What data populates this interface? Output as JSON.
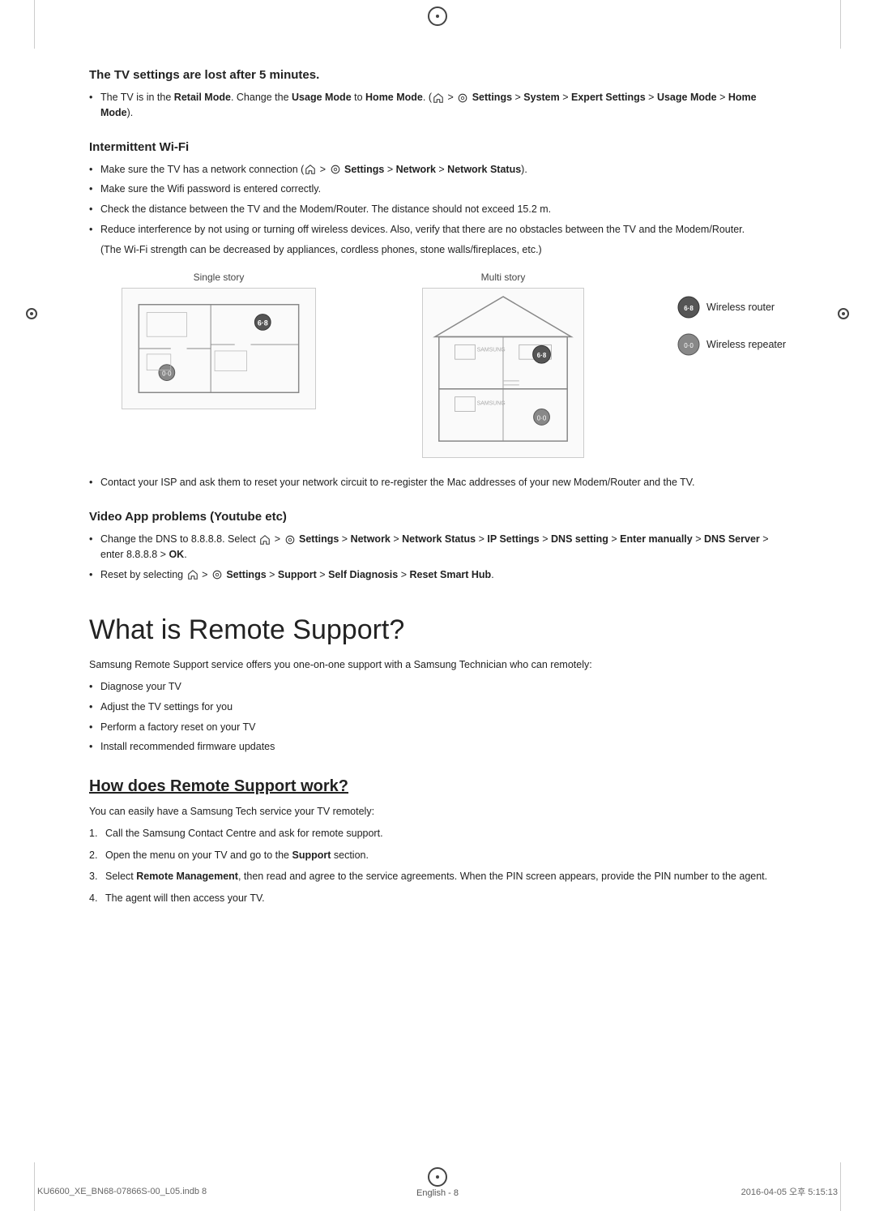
{
  "page": {
    "title": "What is Remote Support?",
    "footer": {
      "left": "KU6600_XE_BN68-07866S-00_L05.indb   8",
      "center": "English - 8",
      "right": "2016-04-05   오후 5:15:13"
    }
  },
  "sections": {
    "tv_settings": {
      "heading": "The TV settings are lost after 5 minutes.",
      "bullet1": "The TV is in the Retail Mode. Change the Usage Mode to Home Mode. (Home > Settings > System > Expert Settings > Usage Mode > Home Mode)."
    },
    "intermittent_wifi": {
      "heading": "Intermittent Wi-Fi",
      "bullet1": "Make sure the TV has a network connection (Home > Settings > Network > Network Status).",
      "bullet2": "Make sure the Wifi password is entered correctly.",
      "bullet3": "Check the distance between the TV and the Modem/Router. The distance should not exceed 15.2 m.",
      "bullet4": "Reduce interference by not using or turning off wireless devices. Also, verify that there are no obstacles between the TV and the Modem/Router.",
      "note": "(The Wi-Fi strength can be decreased by appliances, cordless phones, stone walls/fireplaces, etc.)",
      "diagram_label_left": "Single story",
      "diagram_label_right": "Multi story",
      "legend_router": "Wireless router",
      "legend_repeater": "Wireless repeater",
      "bullet5": "Contact your ISP and ask them to reset your network circuit to re-register the Mac addresses of your new Modem/Router and the TV."
    },
    "video_app": {
      "heading": "Video App problems (Youtube etc)",
      "bullet1_pre": "Change the DNS to 8.8.8.8. Select",
      "bullet1_nav": "Home > Settings > Network > Network Status > IP Settings > DNS setting > Enter manually > DNS Server > enter 8.8.8.8 > OK",
      "bullet2_pre": "Reset by selecting",
      "bullet2_nav": "Home > Settings > Support > Self Diagnosis > Reset Smart Hub",
      "bullet2_end": "."
    },
    "remote_support": {
      "heading": "What is Remote Support?",
      "intro": "Samsung Remote Support service offers you one-on-one support with a Samsung Technician who can remotely:",
      "bullet1": "Diagnose your TV",
      "bullet2": "Adjust the TV settings for you",
      "bullet3": "Perform a factory reset on your TV",
      "bullet4": "Install recommended firmware updates"
    },
    "how_it_works": {
      "heading": "How does Remote Support work?",
      "intro": "You can easily have a Samsung Tech service your TV remotely:",
      "step1": "Call the Samsung Contact Centre and ask for remote support.",
      "step2": "Open the menu on your TV and go to the Support section.",
      "step3": "Select Remote Management, then read and agree to the service agreements. When the PIN screen appears, provide the PIN number to the agent.",
      "step4": "The agent will then access your TV."
    }
  }
}
